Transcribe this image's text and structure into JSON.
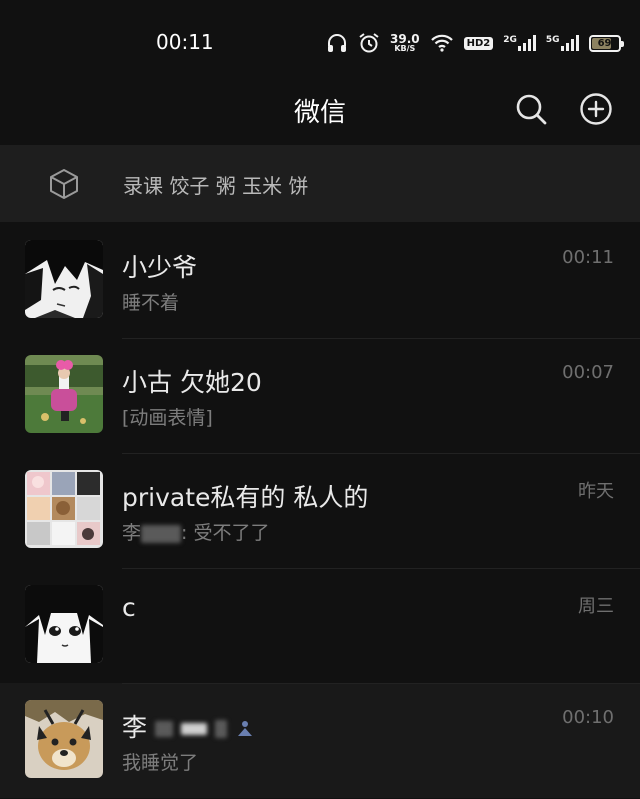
{
  "status_bar": {
    "time": "00:11",
    "net_speed_value": "39.0",
    "net_speed_unit": "KB/S",
    "hd_label": "HD2",
    "sim1_label": "2G",
    "sim2_label": "5G",
    "battery_level": "69",
    "icons": [
      "headphones-icon",
      "alarm-icon",
      "wifi-icon",
      "signal-icon",
      "battery-icon"
    ]
  },
  "header": {
    "title": "微信",
    "icons": [
      "search-icon",
      "add-icon"
    ]
  },
  "pinned_bar": {
    "icon": "cube-icon",
    "text": "录课 饺子 粥 玉米 饼"
  },
  "chats": [
    {
      "name": "小少爷",
      "preview": "睡不着",
      "time": "00:11",
      "avatar": "anime-avatar"
    },
    {
      "name": "小古 欠她20",
      "preview": "[动画表情]",
      "time": "00:07",
      "avatar": "doll-avatar"
    },
    {
      "name": "private私有的 私人的",
      "preview_prefix": "李",
      "preview_suffix": ": 受不了了",
      "time": "昨天",
      "avatar": "group-avatar"
    },
    {
      "name": "c",
      "preview": "",
      "time": "周三",
      "avatar": "anime-girl-avatar"
    },
    {
      "name_prefix": "李",
      "preview": "我睡觉了",
      "time": "00:10",
      "avatar": "dog-avatar"
    }
  ],
  "colors": {
    "background": "#111111",
    "pinned_bar": "#1e1e1e",
    "text_primary": "#e9e9e9",
    "text_secondary": "#7d7d7d"
  }
}
